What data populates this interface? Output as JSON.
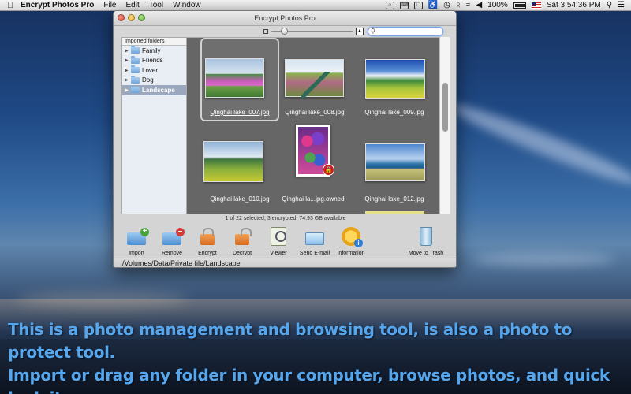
{
  "menubar": {
    "app_name": "Encrypt Photos Pro",
    "menus": [
      "File",
      "Edit",
      "Tool",
      "Window"
    ],
    "battery": "100%",
    "clock": "Sat 3:54:36 PM"
  },
  "window": {
    "title": "Encrypt Photos Pro",
    "search_placeholder": "",
    "sidebar": {
      "header": "Imported folders",
      "folders": [
        {
          "label": "Family",
          "selected": false
        },
        {
          "label": "Friends",
          "selected": false
        },
        {
          "label": "Lover",
          "selected": false
        },
        {
          "label": "Dog",
          "selected": false
        },
        {
          "label": "Landscape",
          "selected": true
        }
      ]
    },
    "photos": [
      {
        "caption": "Qinghai lake_007.jpg",
        "selected": true,
        "encrypted": false
      },
      {
        "caption": "Qinghai lake_008.jpg",
        "selected": false,
        "encrypted": false
      },
      {
        "caption": "Qinghai lake_009.jpg",
        "selected": false,
        "encrypted": false
      },
      {
        "caption": "Qinghai lake_010.jpg",
        "selected": false,
        "encrypted": false
      },
      {
        "caption": "Qinghai la...jpg.owned",
        "selected": false,
        "encrypted": true
      },
      {
        "caption": "Qinghai lake_012.jpg",
        "selected": false,
        "encrypted": false
      }
    ],
    "status_text": "1 of 22 selected, 3 encrypted, 74.93 GB available",
    "tools": [
      {
        "label": "Import",
        "icon": "import-folder-icon"
      },
      {
        "label": "Remove",
        "icon": "remove-folder-icon"
      },
      {
        "label": "Encrypt",
        "icon": "lock-icon"
      },
      {
        "label": "Decrypt",
        "icon": "unlock-icon"
      },
      {
        "label": "Viewer",
        "icon": "viewer-icon"
      },
      {
        "label": "Send E-mail",
        "icon": "mail-icon"
      },
      {
        "label": "Information",
        "icon": "info-icon"
      },
      {
        "label": "Move to Trash",
        "icon": "trash-icon"
      }
    ],
    "path": "/Volumes/Data/Private file/Landscape"
  },
  "promo": {
    "line1": "This is a photo management and browsing tool, is also a photo to protect tool.",
    "line2": "Import or drag any folder in your computer, browse photos, and quick look it."
  },
  "colors": {
    "promo_text": "#56a6ee",
    "sidebar_selected": "#9aa7bd",
    "content_bg": "#666666",
    "lock_badge": "#c8201d"
  }
}
